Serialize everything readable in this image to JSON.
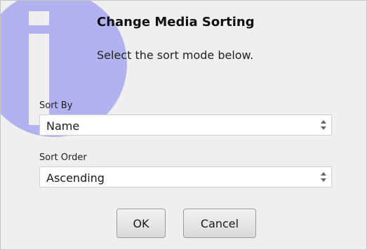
{
  "dialog": {
    "title": "Change Media Sorting",
    "subtitle": "Select the sort mode below.",
    "icon": "info-icon",
    "accent_color": "#b1b2ef"
  },
  "sort_by": {
    "label": "Sort By",
    "value": "Name"
  },
  "sort_order": {
    "label": "Sort Order",
    "value": "Ascending"
  },
  "buttons": {
    "ok_label": "OK",
    "cancel_label": "Cancel"
  }
}
